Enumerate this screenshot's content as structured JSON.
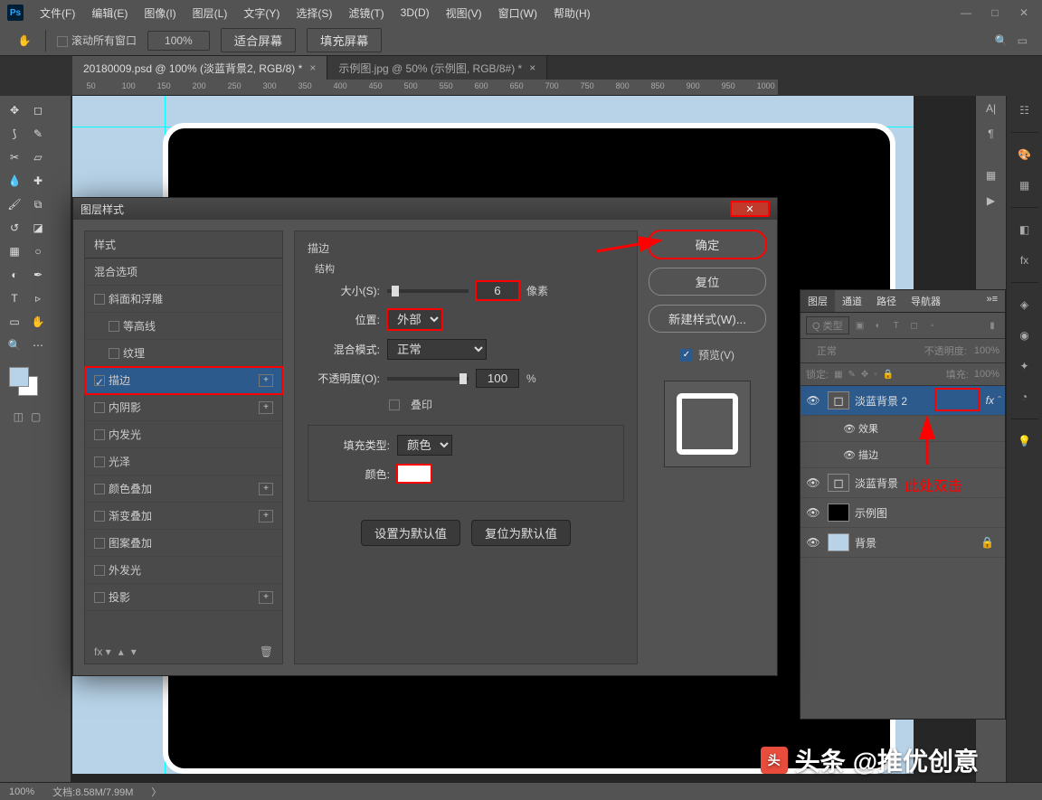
{
  "menu": {
    "items": [
      "文件(F)",
      "编辑(E)",
      "图像(I)",
      "图层(L)",
      "文字(Y)",
      "选择(S)",
      "滤镜(T)",
      "3D(D)",
      "视图(V)",
      "窗口(W)",
      "帮助(H)"
    ]
  },
  "options": {
    "scroll_all": "滚动所有窗口",
    "zoom": "100%",
    "fit": "适合屏幕",
    "fill": "填充屏幕"
  },
  "tabs": [
    {
      "label": "20180009.psd @ 100% (淡蓝背景2, RGB/8) *",
      "active": true
    },
    {
      "label": "示例图.jpg @ 50% (示例图, RGB/8#) *",
      "active": false
    }
  ],
  "ruler_ticks": [
    "50",
    "100",
    "150",
    "200",
    "250",
    "300",
    "350",
    "400",
    "450",
    "500",
    "550",
    "600",
    "650",
    "700",
    "750",
    "800",
    "850",
    "900",
    "950",
    "1000"
  ],
  "dialog": {
    "title": "图层样式",
    "styles_header": "样式",
    "blend_options": "混合选项",
    "style_list": [
      {
        "label": "斜面和浮雕",
        "checked": false,
        "plus": false
      },
      {
        "label": "等高线",
        "checked": false,
        "plus": false,
        "indent": true
      },
      {
        "label": "纹理",
        "checked": false,
        "plus": false,
        "indent": true
      },
      {
        "label": "描边",
        "checked": true,
        "plus": true,
        "selected": true
      },
      {
        "label": "内阴影",
        "checked": false,
        "plus": true
      },
      {
        "label": "内发光",
        "checked": false,
        "plus": false
      },
      {
        "label": "光泽",
        "checked": false,
        "plus": false
      },
      {
        "label": "颜色叠加",
        "checked": false,
        "plus": true
      },
      {
        "label": "渐变叠加",
        "checked": false,
        "plus": true
      },
      {
        "label": "图案叠加",
        "checked": false,
        "plus": false
      },
      {
        "label": "外发光",
        "checked": false,
        "plus": false
      },
      {
        "label": "投影",
        "checked": false,
        "plus": true
      }
    ],
    "stroke": {
      "title": "描边",
      "structure": "结构",
      "size_label": "大小(S):",
      "size_value": "6",
      "size_unit": "像素",
      "position_label": "位置:",
      "position_value": "外部",
      "blend_label": "混合模式:",
      "blend_value": "正常",
      "opacity_label": "不透明度(O):",
      "opacity_value": "100",
      "opacity_unit": "%",
      "overprint": "叠印",
      "fill_type_label": "填充类型:",
      "fill_type_value": "颜色",
      "color_label": "颜色:",
      "set_default": "设置为默认值",
      "reset_default": "复位为默认值"
    },
    "buttons": {
      "ok": "确定",
      "cancel": "复位",
      "new_style": "新建样式(W)...",
      "preview": "预览(V)"
    }
  },
  "layers_panel": {
    "tabs": [
      "图层",
      "通道",
      "路径",
      "导航器"
    ],
    "kind": "Q 类型",
    "blend_mode": "正常",
    "opacity_label": "不透明度:",
    "opacity_val": "100%",
    "lock_label": "锁定:",
    "fill_label": "填充:",
    "fill_val": "100%",
    "layers": [
      {
        "name": "淡蓝背景 2",
        "fx": true,
        "selected": true,
        "thumb": "shape"
      },
      {
        "name": "效果",
        "sub": true,
        "eye": true
      },
      {
        "name": "描边",
        "sub": true,
        "eye": true
      },
      {
        "name": "淡蓝背景",
        "thumb": "shape"
      },
      {
        "name": "示例图",
        "thumb": "black"
      },
      {
        "name": "背景",
        "thumb": "lblue",
        "locked": true
      }
    ]
  },
  "annotations": {
    "dblclick": "此处双击"
  },
  "status": {
    "zoom": "100%",
    "doc": "文档:8.58M/7.99M"
  },
  "watermark": "@推优创意",
  "watermark_prefix": "头条"
}
